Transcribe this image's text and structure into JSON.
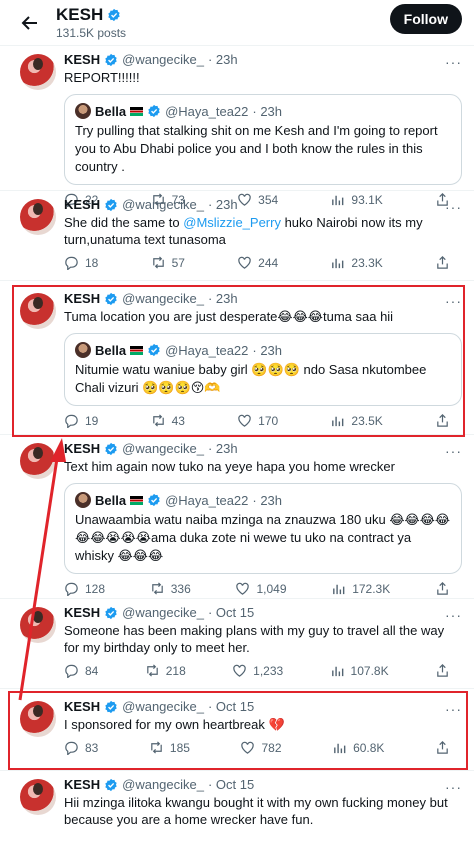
{
  "header": {
    "name": "KESH",
    "posts": "131.5K posts",
    "follow_label": "Follow"
  },
  "tweets": [
    {
      "name": "KESH",
      "handle": "@wangecike_",
      "time": "· 23h",
      "text": "REPORT!!!!!!",
      "quote": {
        "name": "Bella",
        "flag_text": "🇰🇪",
        "handle": "@Haya_tea22",
        "time": "· 23h",
        "text": "Try pulling that stalking shit on me Kesh and I'm going to report you to Abu Dhabi police you and I both know the rules in this country ."
      },
      "replies": "22",
      "reposts": "73",
      "likes": "354",
      "views": "93.1K"
    },
    {
      "name": "KESH",
      "handle": "@wangecike_",
      "time": "· 23h",
      "text_pre": "She did the same to ",
      "mention": "@Mslizzie_Perry",
      "text_post": " huko Nairobi now its my turn,unatuma text tunasoma",
      "replies": "18",
      "reposts": "57",
      "likes": "244",
      "views": "23.3K"
    },
    {
      "name": "KESH",
      "handle": "@wangecike_",
      "time": "· 23h",
      "text": "Tuma location you are just desperate😂😂😂tuma saa hii",
      "quote": {
        "name": "Bella",
        "flag_text": "🇰🇪",
        "handle": "@Haya_tea22",
        "time": "· 23h",
        "text": "Nitumie watu waniue baby girl 🥺🥺🥺 ndo Sasa nkutombee Chali vizuri 🥺🥺🥺😚🫶"
      },
      "replies": "19",
      "reposts": "43",
      "likes": "170",
      "views": "23.5K"
    },
    {
      "name": "KESH",
      "handle": "@wangecike_",
      "time": "· 23h",
      "text": "Text him again now tuko na yeye hapa you home wrecker",
      "quote": {
        "name": "Bella",
        "flag_text": "🇰🇪",
        "handle": "@Haya_tea22",
        "time": "· 23h",
        "text": "Unawaambia watu naiba mzinga na znauzwa 180 uku 😂😂😂😂😂😂😭😭😭ama duka zote ni wewe tu uko na contract ya whisky 😂😂😂"
      },
      "replies": "128",
      "reposts": "336",
      "likes": "1,049",
      "views": "172.3K"
    },
    {
      "name": "KESH",
      "handle": "@wangecike_",
      "time": "· Oct 15",
      "text": "Someone has been making plans with my guy to travel all the way for my birthday only to meet her.",
      "replies": "84",
      "reposts": "218",
      "likes": "1,233",
      "views": "107.8K"
    },
    {
      "name": "KESH",
      "handle": "@wangecike_",
      "time": "· Oct 15",
      "text": "I sponsored for my own heartbreak 💔",
      "replies": "83",
      "reposts": "185",
      "likes": "782",
      "views": "60.8K"
    },
    {
      "name": "KESH",
      "handle": "@wangecike_",
      "time": "· Oct 15",
      "text": "Hii mzinga ilitoka kwangu bought it with my own fucking money but because you are a home wrecker have fun."
    }
  ],
  "colors": {
    "annotation_red": "#e0242b",
    "verified_blue": "#1d9bf0",
    "text_secondary": "#536471"
  }
}
